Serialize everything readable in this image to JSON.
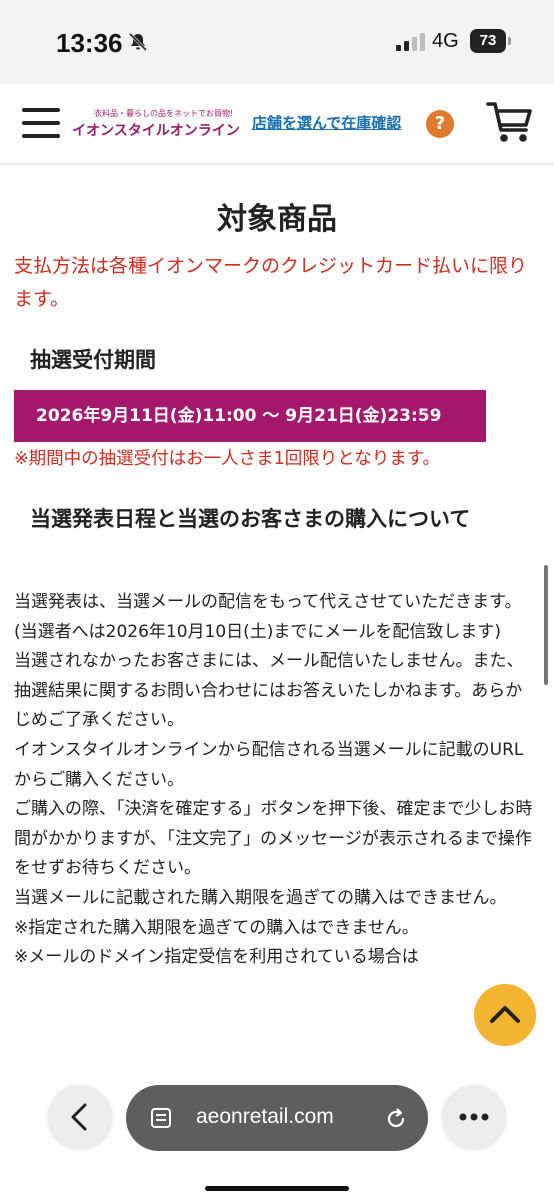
{
  "status_bar": {
    "time": "13:36",
    "network": "4G",
    "battery": "73"
  },
  "header": {
    "logo_tagline": "衣料品・暮らしの品をネットでお買物!",
    "logo_name": "イオンスタイルオンライン",
    "store_link": "店舗を選んで在庫確認",
    "help_label": "?"
  },
  "main": {
    "section_title": "対象商品",
    "payment_notice": "支払方法は各種イオンマークのクレジットカード払いに限ります。",
    "lottery_heading": "抽選受付期間",
    "lottery_period": "2026年9月11日(金)11:00 〜 9月21日(金)23:59",
    "lottery_note": "※期間中の抽選受付はお一人さま1回限りとなります。",
    "announce_heading": "当選発表日程と当選のお客さまの購入について",
    "paragraphs": [
      "当選発表は、当選メールの配信をもって代えさせていただきます。",
      "(当選者へは2026年10月10日(土)までにメールを配信致します)",
      "当選されなかったお客さまには、メール配信いたしません。また、抽選結果に関するお問い合わせにはお答えいたしかねます。あらかじめご了承ください。",
      "イオンスタイルオンラインから配信される当選メールに記載のURLからご購入ください。",
      "ご購入の際、「決済を確定する」ボタンを押下後、確定まで少しお時間がかかりますが、「注文完了」のメッセージが表示されるまで操作をせずお待ちください。",
      "当選メールに記載された購入期限を過ぎての購入はできません。",
      "※指定された購入期限を過ぎての購入はできません。",
      "※メールのドメイン指定受信を利用されている場合は"
    ]
  },
  "browser": {
    "url": "aeonretail.com"
  },
  "colors": {
    "brand": "#a4196e",
    "alert": "#d42b1e",
    "link": "#1a6fb0",
    "scroll_top": "#f3b431"
  },
  "icons": [
    "bell-slash-icon",
    "signal-icon",
    "battery-icon",
    "hamburger-icon",
    "help-icon",
    "cart-icon",
    "chevron-up-icon",
    "back-icon",
    "page-icon",
    "reload-icon",
    "more-icon"
  ]
}
